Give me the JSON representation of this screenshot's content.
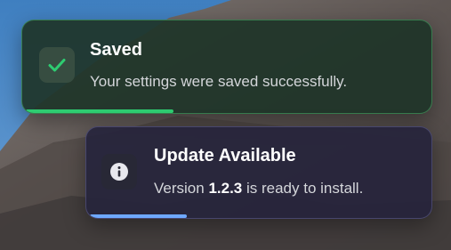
{
  "toasts": [
    {
      "type": "success",
      "icon": "checkmark-icon",
      "title": "Saved",
      "message": "Your settings were saved successfully.",
      "progress": 0.36,
      "accent_color": "#2ecc71"
    },
    {
      "type": "info",
      "icon": "info-icon",
      "title": "Update Available",
      "message_prefix": "Version ",
      "message_version": "1.2.3",
      "message_suffix": " is ready to install.",
      "progress": 0.28,
      "accent_color": "#6ea8ff"
    }
  ]
}
